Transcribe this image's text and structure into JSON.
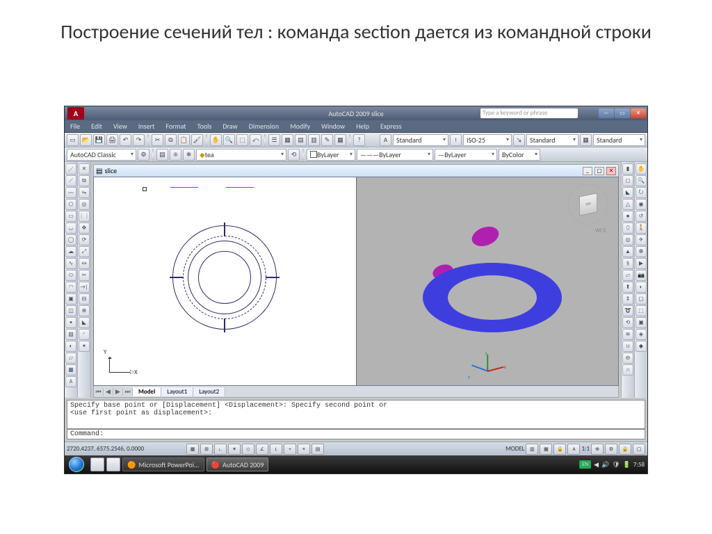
{
  "slide": {
    "title": "Построение сечений тел : команда section дается из командной строки"
  },
  "titlebar": {
    "app_label": "A",
    "window_title": "AutoCAD 2009 slice",
    "search_placeholder": "Type a keyword or phrase",
    "min": "—",
    "max": "▭",
    "close": "✕"
  },
  "menu": {
    "items": [
      "File",
      "Edit",
      "View",
      "Insert",
      "Format",
      "Tools",
      "Draw",
      "Dimension",
      "Modify",
      "Window",
      "Help",
      "Express"
    ]
  },
  "toolbars": {
    "row1_annot": {
      "style1": "Standard",
      "style2": "ISO-25",
      "style3": "Standard",
      "style4": "Standard"
    },
    "row2": {
      "workspace": "AutoCAD Classic",
      "layer": "tea",
      "linetype": "ByLayer",
      "lineweight": "ByLayer",
      "color": "ByColor"
    }
  },
  "doc": {
    "name": "slice",
    "min": "_",
    "max": "▢",
    "close": "✕"
  },
  "leftview": {
    "axis_y": "Y",
    "axis_x": "X"
  },
  "rightview": {
    "cube": "TOP",
    "wcs": "WCS",
    "tx": "x",
    "ty": "y",
    "tz": "z"
  },
  "tabs": {
    "model": "Model",
    "l1": "Layout1",
    "l2": "Layout2"
  },
  "command": {
    "history": "Specify base point or [Displacement] <Displacement>: Specify second point or\n<use first point as displacement>:",
    "prompt": "Command:"
  },
  "status": {
    "coords": "2720.4237, 6575.2546, 0.0000",
    "model": "MODEL",
    "scale": "1:1"
  },
  "taskbar": {
    "apps": [
      {
        "icon": "🟠",
        "label": "Microsoft PowerPoi..."
      },
      {
        "icon": "🔴",
        "label": "AutoCAD 2009"
      }
    ],
    "lang": "EN",
    "time": "7:58"
  }
}
